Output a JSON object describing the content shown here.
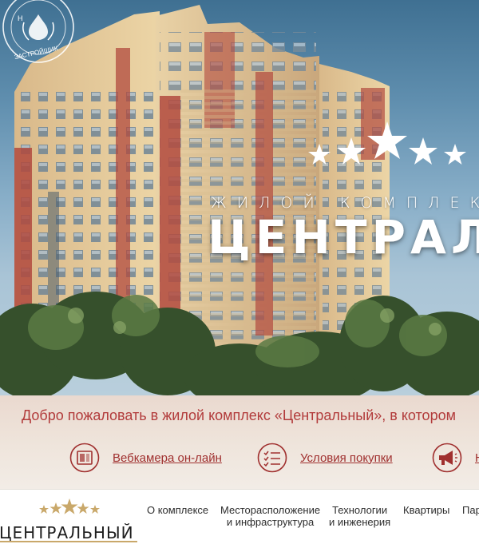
{
  "hero": {
    "seal_top": "Н",
    "seal_bottom": "ЗАСТРОЙЩИК",
    "subtitle": "ЖИЛОЙ КОМПЛЕКС",
    "title": "ЦЕНТРАЛЬНЫЙ",
    "star_count": 5
  },
  "welcome": {
    "text": "Добро пожаловать в жилой комплекс «Центральный», в котором"
  },
  "quick_links": [
    {
      "label": "Вебкамера он-лайн",
      "icon": "webcam-icon"
    },
    {
      "label": "Условия покупки",
      "icon": "checklist-icon"
    },
    {
      "label": "Н",
      "icon": "megaphone-icon"
    }
  ],
  "navbar": {
    "logo_text": "ЦЕНТРАЛЬНЫЙ",
    "items": [
      {
        "line1": "О комплексе",
        "line2": ""
      },
      {
        "line1": "Месторасположение",
        "line2": "и инфраструктура"
      },
      {
        "line1": "Технологии",
        "line2": "и инженерия"
      },
      {
        "line1": "Квартиры",
        "line2": ""
      },
      {
        "line1": "Пар",
        "line2": ""
      }
    ]
  },
  "colors": {
    "accent_red": "#a0302f",
    "gold": "#c9a86a",
    "facade": "#e8cf9e",
    "balcony_red": "#b24a3e"
  }
}
